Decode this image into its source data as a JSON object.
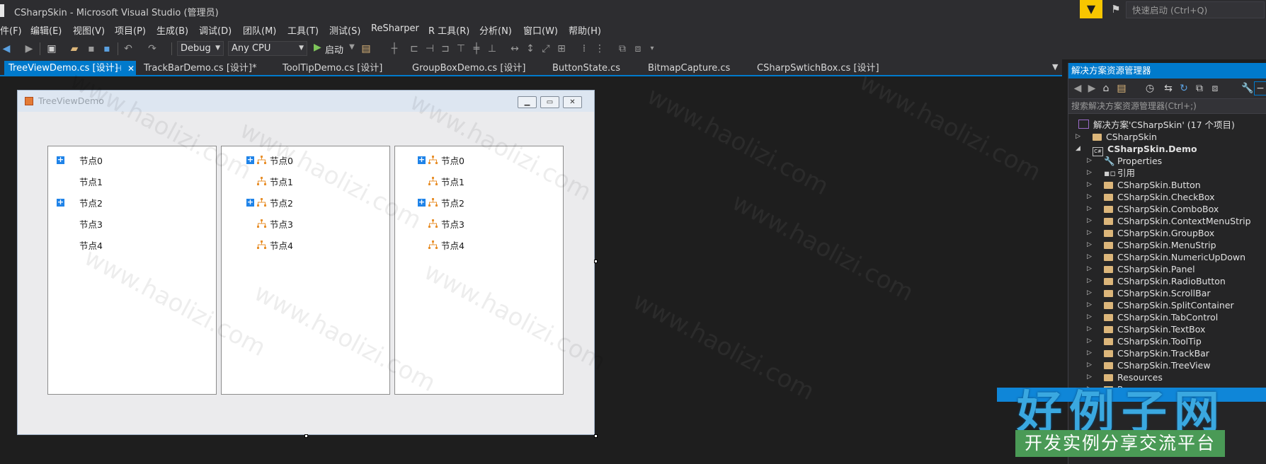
{
  "window": {
    "title": "CSharpSkin - Microsoft Visual Studio (管理员)"
  },
  "quick_launch": {
    "placeholder": "快速启动 (Ctrl+Q)"
  },
  "menu": [
    "件(F)",
    "编辑(E)",
    "视图(V)",
    "项目(P)",
    "生成(B)",
    "调试(D)",
    "团队(M)",
    "工具(T)",
    "测试(S)",
    "ReSharper",
    "R 工具(R)",
    "分析(N)",
    "窗口(W)",
    "帮助(H)"
  ],
  "toolbar": {
    "config": "Debug",
    "platform": "Any CPU",
    "start_label": "启动"
  },
  "tabs": [
    {
      "label": "TreeViewDemo.cs [设计]",
      "active": true
    },
    {
      "label": "TrackBarDemo.cs [设计]*"
    },
    {
      "label": "ToolTipDemo.cs [设计]"
    },
    {
      "label": "GroupBoxDemo.cs [设计]"
    },
    {
      "label": "ButtonState.cs"
    },
    {
      "label": "BitmapCapture.cs"
    },
    {
      "label": "CSharpSwtichBox.cs [设计]"
    }
  ],
  "form": {
    "title": "TreeViewDemo",
    "trees": [
      {
        "nodes": [
          "节点0",
          "节点1",
          "节点2",
          "节点3",
          "节点4"
        ],
        "expandable": [
          true,
          false,
          true,
          false,
          false
        ],
        "icons": false
      },
      {
        "nodes": [
          "节点0",
          "节点1",
          "节点2",
          "节点3",
          "节点4"
        ],
        "expandable": [
          true,
          false,
          true,
          false,
          false
        ],
        "icons": true
      },
      {
        "nodes": [
          "节点0",
          "节点1",
          "节点2",
          "节点3",
          "节点4"
        ],
        "expandable": [
          true,
          false,
          true,
          false,
          false
        ],
        "icons": true
      }
    ]
  },
  "solution_explorer": {
    "title": "解决方案资源管理器",
    "search_placeholder": "搜索解决方案资源管理器(Ctrl+;)",
    "solution": "解决方案'CSharpSkin' (17 个项目)",
    "items": [
      {
        "label": "CSharpSkin",
        "level": 1,
        "expanded": false
      },
      {
        "label": "CSharpSkin.Demo",
        "level": 1,
        "expanded": true,
        "bold": true
      },
      {
        "label": "Properties",
        "level": 2
      },
      {
        "label": "引用",
        "level": 2
      },
      {
        "label": "CSharpSkin.Button",
        "level": 2
      },
      {
        "label": "CSharpSkin.CheckBox",
        "level": 2
      },
      {
        "label": "CSharpSkin.ComboBox",
        "level": 2
      },
      {
        "label": "CSharpSkin.ContextMenuStrip",
        "level": 2
      },
      {
        "label": "CSharpSkin.GroupBox",
        "level": 2
      },
      {
        "label": "CSharpSkin.MenuStrip",
        "level": 2
      },
      {
        "label": "CSharpSkin.NumericUpDown",
        "level": 2
      },
      {
        "label": "CSharpSkin.Panel",
        "level": 2
      },
      {
        "label": "CSharpSkin.RadioButton",
        "level": 2
      },
      {
        "label": "CSharpSkin.ScrollBar",
        "level": 2
      },
      {
        "label": "CSharpSkin.SplitContainer",
        "level": 2
      },
      {
        "label": "CSharpSkin.TabControl",
        "level": 2
      },
      {
        "label": "CSharpSkin.TextBox",
        "level": 2
      },
      {
        "label": "CSharpSkin.ToolTip",
        "level": 2
      },
      {
        "label": "CSharpSkin.TrackBar",
        "level": 2
      },
      {
        "label": "CSharpSkin.TreeView",
        "level": 2
      },
      {
        "label": "Resources",
        "level": 2
      },
      {
        "label": "Resources",
        "level": 2
      }
    ]
  },
  "watermark": {
    "text": "www.haolizi.com"
  },
  "branding": {
    "logo": "好例子网",
    "tagline": "开发实例分享交流平台"
  },
  "colors": {
    "accent": "#007acc",
    "folder": "#dcb67a",
    "node_plus": "#1f83e8"
  }
}
